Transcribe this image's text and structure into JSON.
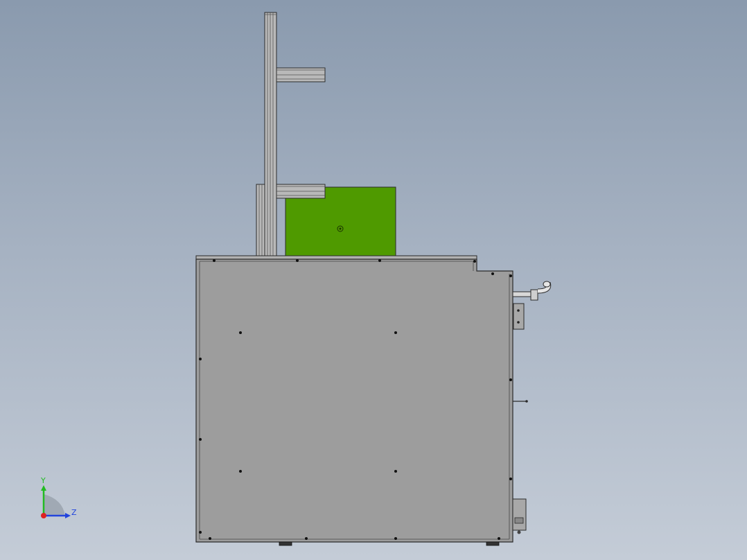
{
  "viewport": {
    "background_top": "#8a9aae",
    "background_bottom": "#c4ccd7"
  },
  "model": {
    "cabinet_color": "#9d9d9d",
    "frame_color": "#b4b4b4",
    "green_box_color": "#4f9a00",
    "edge_color": "#2a2a2a"
  },
  "triad": {
    "y_label": "Y",
    "z_label": "Z",
    "y_color": "#22bb22",
    "z_color": "#2244dd",
    "x_color": "#dd2222"
  }
}
